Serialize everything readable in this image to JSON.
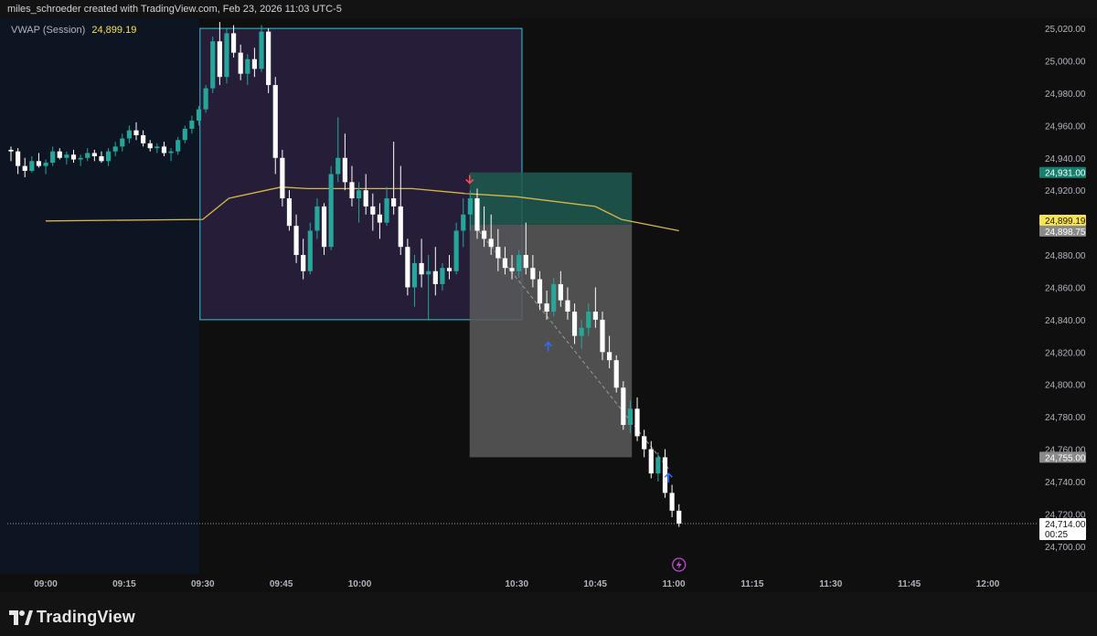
{
  "header": {
    "attribution": "miles_schroeder created with TradingView.com, Feb 23, 2026 11:03 UTC-5"
  },
  "legend": {
    "name": "VWAP (Session)",
    "value": "24,899.19"
  },
  "footer": {
    "logo_text": "TradingView"
  },
  "colors": {
    "background": "#0f0f10",
    "premarket_bg": "#0d1422",
    "up_candle": "#26a69a",
    "down_candle": "#ffffff",
    "vwap": "#d7b84a",
    "range_box_fill": "#2a2140",
    "range_box_border": "#34c3de",
    "target_zone": "#1e5a4f",
    "stop_zone": "#5a5a5a",
    "sell_arrow": "#ff4d5a",
    "buy_arrow": "#2f6dff"
  },
  "chart_data": {
    "type": "candlestick",
    "symbol_session_date": "Feb 23, 2026",
    "time_ticks": [
      "09:00",
      "09:15",
      "09:30",
      "09:45",
      "10:00",
      "10:30",
      "10:45",
      "11:00",
      "11:15",
      "11:30",
      "11:45",
      "12:00"
    ],
    "price_ticks": [
      "25,020.00",
      "25,000.00",
      "24,980.00",
      "24,960.00",
      "24,940.00",
      "24,920.00",
      "24,880.00",
      "24,860.00",
      "24,840.00",
      "24,820.00",
      "24,800.00",
      "24,780.00",
      "24,760.00",
      "24,740.00",
      "24,720.00",
      "24,700.00"
    ],
    "ylim": [
      24692,
      25024
    ],
    "price_labels": [
      {
        "text": "24,931.00",
        "value": 24931,
        "style": "target"
      },
      {
        "text": "24,899.19",
        "value": 24899.19,
        "style": "vwap"
      },
      {
        "text": "24,898.75",
        "value": 24898.75,
        "style": "entry"
      },
      {
        "text": "24,755.00",
        "value": 24755,
        "style": "stop"
      },
      {
        "text": "24,714.00",
        "value": 24714,
        "style": "last",
        "sub": "00:25"
      }
    ],
    "annotations": {
      "opening_range": {
        "t_start": "09:30",
        "t_end": "10:31",
        "high": 25020,
        "low": 24840
      },
      "trade": {
        "t_start": "10:21",
        "t_end": "10:52",
        "entry": 24898.75,
        "target": 24931,
        "stop": 24755
      },
      "sell_signal": {
        "time": "10:21",
        "price": 24921
      },
      "buy_signals": [
        {
          "time": "10:36",
          "price": 24826
        },
        {
          "time": "10:59",
          "price": 24745
        }
      ],
      "lightning_marker": {
        "time": "11:01"
      }
    },
    "vwap_points": [
      {
        "time": "09:00",
        "value": 24901
      },
      {
        "time": "09:30",
        "value": 24902
      },
      {
        "time": "09:35",
        "value": 24915
      },
      {
        "time": "09:45",
        "value": 24922
      },
      {
        "time": "09:50",
        "value": 24921
      },
      {
        "time": "10:10",
        "value": 24921
      },
      {
        "time": "10:20",
        "value": 24918
      },
      {
        "time": "10:30",
        "value": 24916
      },
      {
        "time": "10:45",
        "value": 24910
      },
      {
        "time": "10:50",
        "value": 24902
      },
      {
        "time": "11:01",
        "value": 24895
      }
    ],
    "candles": [
      [
        24945,
        24947,
        24938,
        24944
      ],
      [
        24944,
        24946,
        24930,
        24935
      ],
      [
        24935,
        24940,
        24928,
        24932
      ],
      [
        24932,
        24941,
        24931,
        24938
      ],
      [
        24938,
        24943,
        24934,
        24935
      ],
      [
        24935,
        24939,
        24930,
        24937
      ],
      [
        24937,
        24947,
        24935,
        24944
      ],
      [
        24944,
        24946,
        24939,
        24940
      ],
      [
        24940,
        24944,
        24936,
        24942
      ],
      [
        24942,
        24945,
        24937,
        24939
      ],
      [
        24939,
        24942,
        24935,
        24940
      ],
      [
        24940,
        24946,
        24938,
        24943
      ],
      [
        24943,
        24945,
        24938,
        24941
      ],
      [
        24941,
        24944,
        24937,
        24938
      ],
      [
        24938,
        24946,
        24935,
        24944
      ],
      [
        24944,
        24950,
        24941,
        24947
      ],
      [
        24947,
        24955,
        24944,
        24952
      ],
      [
        24952,
        24960,
        24949,
        24957
      ],
      [
        24957,
        24962,
        24951,
        24954
      ],
      [
        24954,
        24957,
        24947,
        24949
      ],
      [
        24949,
        24951,
        24944,
        24946
      ],
      [
        24946,
        24949,
        24943,
        24947
      ],
      [
        24947,
        24950,
        24941,
        24943
      ],
      [
        24943,
        24946,
        24938,
        24944
      ],
      [
        24944,
        24953,
        24942,
        24951
      ],
      [
        24951,
        24960,
        24949,
        24958
      ],
      [
        24958,
        24966,
        24955,
        24963
      ],
      [
        24963,
        24972,
        24960,
        24970
      ],
      [
        24970,
        24985,
        24968,
        24983
      ],
      [
        24983,
        25015,
        24980,
        25012
      ],
      [
        25012,
        25024,
        24985,
        24990
      ],
      [
        24990,
        25020,
        24986,
        25017
      ],
      [
        25017,
        25022,
        25002,
        25005
      ],
      [
        25005,
        25010,
        24988,
        24992
      ],
      [
        24992,
        25004,
        24985,
        25001
      ],
      [
        25001,
        25008,
        24990,
        24995
      ],
      [
        24995,
        25022,
        24993,
        25018
      ],
      [
        25018,
        25020,
        24980,
        24985
      ],
      [
        24985,
        24990,
        24930,
        24940
      ],
      [
        24940,
        24945,
        24910,
        24915
      ],
      [
        24915,
        24920,
        24895,
        24898
      ],
      [
        24898,
        24905,
        24875,
        24880
      ],
      [
        24880,
        24890,
        24865,
        24870
      ],
      [
        24870,
        24900,
        24868,
        24895
      ],
      [
        24895,
        24915,
        24890,
        24910
      ],
      [
        24910,
        24912,
        24880,
        24885
      ],
      [
        24885,
        24935,
        24883,
        24930
      ],
      [
        24930,
        24965,
        24925,
        24940
      ],
      [
        24940,
        24955,
        24920,
        24925
      ],
      [
        24925,
        24935,
        24910,
        24915
      ],
      [
        24915,
        24925,
        24900,
        24920
      ],
      [
        24920,
        24930,
        24905,
        24910
      ],
      [
        24910,
        24918,
        24895,
        24905
      ],
      [
        24905,
        24912,
        24890,
        24900
      ],
      [
        24900,
        24922,
        24898,
        24915
      ],
      [
        24915,
        24950,
        24905,
        24910
      ],
      [
        24910,
        24935,
        24880,
        24885
      ],
      [
        24885,
        24890,
        24855,
        24860
      ],
      [
        24860,
        24880,
        24848,
        24875
      ],
      [
        24875,
        24890,
        24860,
        24868
      ],
      [
        24868,
        24880,
        24840,
        24870
      ],
      [
        24870,
        24885,
        24855,
        24862
      ],
      [
        24862,
        24875,
        24858,
        24872
      ],
      [
        24872,
        24880,
        24865,
        24870
      ],
      [
        24870,
        24900,
        24868,
        24895
      ],
      [
        24895,
        24915,
        24885,
        24905
      ],
      [
        24905,
        24920,
        24895,
        24915
      ],
      [
        24915,
        24921,
        24890,
        24895
      ],
      [
        24895,
        24910,
        24885,
        24890
      ],
      [
        24890,
        24905,
        24880,
        24885
      ],
      [
        24885,
        24896,
        24870,
        24878
      ],
      [
        24878,
        24885,
        24868,
        24872
      ],
      [
        24872,
        24880,
        24865,
        24870
      ],
      [
        24870,
        24883,
        24866,
        24880
      ],
      [
        24880,
        24900,
        24868,
        24872
      ],
      [
        24872,
        24880,
        24860,
        24865
      ],
      [
        24865,
        24870,
        24846,
        24850
      ],
      [
        24850,
        24858,
        24840,
        24845
      ],
      [
        24845,
        24866,
        24842,
        24862
      ],
      [
        24862,
        24870,
        24848,
        24852
      ],
      [
        24852,
        24860,
        24840,
        24845
      ],
      [
        24845,
        24850,
        24825,
        24830
      ],
      [
        24830,
        24840,
        24822,
        24835
      ],
      [
        24835,
        24850,
        24830,
        24845
      ],
      [
        24845,
        24860,
        24835,
        24840
      ],
      [
        24840,
        24845,
        24815,
        24820
      ],
      [
        24820,
        24830,
        24810,
        24815
      ],
      [
        24815,
        24818,
        24795,
        24798
      ],
      [
        24798,
        24802,
        24772,
        24775
      ],
      [
        24775,
        24790,
        24770,
        24785
      ],
      [
        24785,
        24792,
        24765,
        24768
      ],
      [
        24768,
        24772,
        24755,
        24760
      ],
      [
        24760,
        24765,
        24742,
        24745
      ],
      [
        24745,
        24758,
        24740,
        24755
      ],
      [
        24755,
        24760,
        24730,
        24733
      ],
      [
        24733,
        24738,
        24718,
        24722
      ],
      [
        24722,
        24726,
        24712,
        24714
      ]
    ]
  }
}
